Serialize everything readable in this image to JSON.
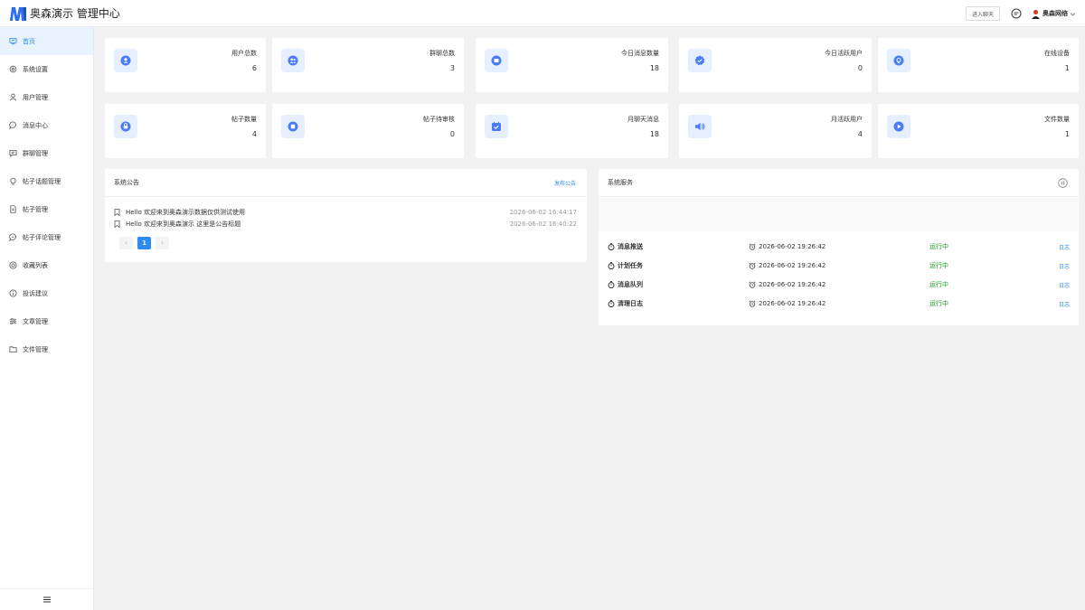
{
  "header": {
    "title": "奥森演示 管理中心",
    "enter_chat": "进入聊天",
    "user_name": "奥森网络"
  },
  "sidebar": {
    "items": [
      {
        "label": "首页",
        "icon": "monitor-icon",
        "active": true
      },
      {
        "label": "系统设置",
        "icon": "gear-icon"
      },
      {
        "label": "用户管理",
        "icon": "user-icon"
      },
      {
        "label": "消息中心",
        "icon": "chat-icon"
      },
      {
        "label": "群聊管理",
        "icon": "group-chat-icon"
      },
      {
        "label": "帖子话题管理",
        "icon": "bulb-icon"
      },
      {
        "label": "帖子管理",
        "icon": "document-icon"
      },
      {
        "label": "帖子评论管理",
        "icon": "comment-icon"
      },
      {
        "label": "收藏列表",
        "icon": "star-circle-icon"
      },
      {
        "label": "投诉建议",
        "icon": "info-icon"
      },
      {
        "label": "文章管理",
        "icon": "sliders-icon"
      },
      {
        "label": "文件管理",
        "icon": "folder-icon"
      }
    ]
  },
  "stats_row1": [
    {
      "label": "用户总数",
      "value": "6",
      "icon": "user-circle-icon"
    },
    {
      "label": "群聊总数",
      "value": "3",
      "icon": "group-icon"
    },
    {
      "label": "今日消息数量",
      "value": "18",
      "icon": "message-icon"
    },
    {
      "label": "今日活跃用户",
      "value": "0",
      "icon": "badge-check-icon"
    },
    {
      "label": "在线设备",
      "value": "1",
      "icon": "bulb-circle-icon"
    }
  ],
  "stats_row2": [
    {
      "label": "帖子数量",
      "value": "4",
      "icon": "lock-icon"
    },
    {
      "label": "帖子待审核",
      "value": "0",
      "icon": "stop-icon"
    },
    {
      "label": "月聊天消息",
      "value": "18",
      "icon": "calendar-check-icon"
    },
    {
      "label": "月活跃用户",
      "value": "4",
      "icon": "speaker-icon"
    },
    {
      "label": "文件数量",
      "value": "1",
      "icon": "play-icon"
    }
  ],
  "notice": {
    "title": "系统公告",
    "publish_link": "发布公告",
    "items": [
      {
        "text": "Hello 欢迎来到奥森演示数据仅供测试使用",
        "date": "2026-06-02 16:44:17"
      },
      {
        "text": "Hello 欢迎来到奥森演示 这里是公告标题",
        "date": "2026-06-02 16:40:22"
      }
    ],
    "pager": {
      "prev": "‹",
      "current": "1",
      "next": "›"
    }
  },
  "services": {
    "title": "系统服务",
    "log_label": "日志",
    "items": [
      {
        "name": "消息推送",
        "time": "2026-06-02 19:26:42",
        "status": "运行中"
      },
      {
        "name": "计划任务",
        "time": "2026-06-02 19:26:42",
        "status": "运行中"
      },
      {
        "name": "消息队列",
        "time": "2026-06-02 19:26:42",
        "status": "运行中"
      },
      {
        "name": "清理日志",
        "time": "2026-06-02 19:26:42",
        "status": "运行中"
      }
    ]
  },
  "colors": {
    "accent": "#2d8cf0",
    "running": "#19a01d",
    "icon_bg": "#e6efff",
    "icon_fg": "#4a7cf6"
  }
}
